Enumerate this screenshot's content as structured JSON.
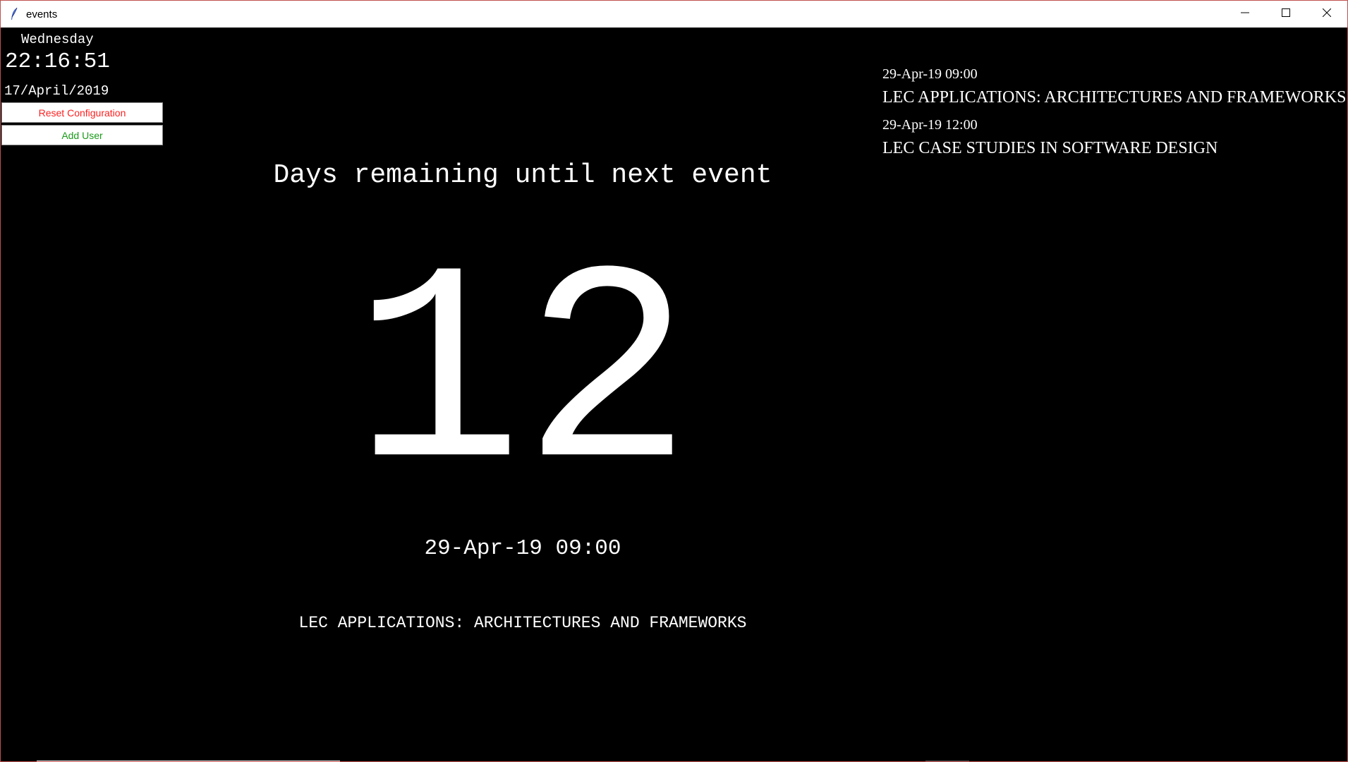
{
  "window": {
    "title": "events"
  },
  "icons": {
    "app": "feather-icon",
    "minimize": "minimize-icon",
    "maximize": "maximize-icon",
    "close": "close-icon"
  },
  "clock": {
    "day": "Wednesday",
    "time": "22:16:51",
    "date": "17/April/2019"
  },
  "buttons": {
    "reset": "Reset Configuration",
    "add_user": "Add User"
  },
  "colors": {
    "background": "#000000",
    "text": "#ffffff",
    "reset_button_text": "#ff2020",
    "add_user_button_text": "#1a9a1a"
  },
  "countdown": {
    "heading": "Days remaining until next event",
    "days": "12",
    "event_date": "29-Apr-19 09:00",
    "event_name": "LEC APPLICATIONS: ARCHITECTURES AND FRAMEWORKS"
  },
  "events": [
    {
      "date": "29-Apr-19 09:00",
      "name": "LEC APPLICATIONS: ARCHITECTURES AND FRAMEWORKS"
    },
    {
      "date": "29-Apr-19 12:00",
      "name": "LEC CASE STUDIES IN SOFTWARE DESIGN"
    }
  ]
}
